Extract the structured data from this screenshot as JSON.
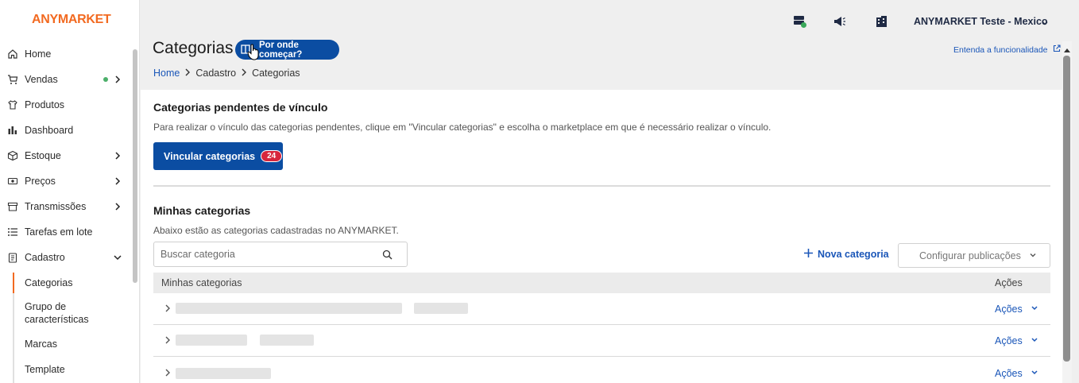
{
  "app": {
    "logo": "ANYMARKET"
  },
  "sidebar": {
    "items": [
      {
        "label": "Home",
        "icon": "home-icon",
        "has_children": false
      },
      {
        "label": "Vendas",
        "icon": "cart-icon",
        "has_children": true,
        "status_dot": "#4caf6a"
      },
      {
        "label": "Produtos",
        "icon": "shirt-icon",
        "has_children": false
      },
      {
        "label": "Dashboard",
        "icon": "bar-chart-icon",
        "has_children": false
      },
      {
        "label": "Estoque",
        "icon": "box-icon",
        "has_children": true
      },
      {
        "label": "Preços",
        "icon": "money-icon",
        "has_children": true
      },
      {
        "label": "Transmissões",
        "icon": "store-icon",
        "has_children": true
      },
      {
        "label": "Tarefas em lote",
        "icon": "list-icon",
        "has_children": false
      },
      {
        "label": "Cadastro",
        "icon": "clipboard-icon",
        "has_children": true,
        "expanded": true
      }
    ],
    "sub_items": [
      {
        "label": "Categorias",
        "active": true
      },
      {
        "label": "Grupo de características"
      },
      {
        "label": "Marcas"
      },
      {
        "label": "Template"
      }
    ]
  },
  "topbar": {
    "icons": [
      "server-status-icon",
      "megaphone-icon",
      "building-icon"
    ],
    "account": "ANYMARKET Teste - Mexico"
  },
  "header": {
    "title": "Categorias",
    "help_button": "Por onde começar?",
    "help_link": "Entenda a funcionalidade",
    "breadcrumb": [
      "Home",
      "Cadastro",
      "Categorias"
    ]
  },
  "pending": {
    "title": "Categorias pendentes de vínculo",
    "description": "Para realizar o vínculo das categorias pendentes, clique em \"Vincular categorias\" e escolha o marketplace em que é necessário realizar o vínculo.",
    "button": "Vincular categorias",
    "count": "24"
  },
  "mine": {
    "title": "Minhas categorias",
    "description": "Abaixo estão as categorias cadastradas no ANYMARKET.",
    "search_placeholder": "Buscar categoria",
    "new_button": "Nova categoria",
    "config_button": "Configurar publicações",
    "table": {
      "columns": [
        "Minhas categorias",
        "Ações"
      ],
      "rows": [
        {
          "action": "Ações"
        },
        {
          "action": "Ações"
        },
        {
          "action": "Ações"
        }
      ]
    }
  },
  "colors": {
    "brand": "#f26a21",
    "primary": "#0b4da2",
    "link": "#1a56b8",
    "badge": "#d7263d"
  }
}
